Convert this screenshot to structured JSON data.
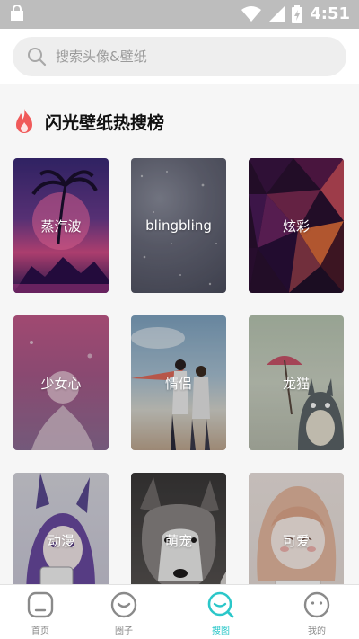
{
  "status_bar": {
    "time": "4:51"
  },
  "search": {
    "placeholder": "搜索头像&壁纸"
  },
  "section": {
    "title": "闪光壁纸热搜榜"
  },
  "cards": [
    {
      "label": "蒸汽波"
    },
    {
      "label": "blingbling"
    },
    {
      "label": "炫彩"
    },
    {
      "label": "少女心"
    },
    {
      "label": "情侣"
    },
    {
      "label": "龙猫"
    },
    {
      "label": "动漫"
    },
    {
      "label": "萌宠"
    },
    {
      "label": "可爱"
    }
  ],
  "bottom_nav": [
    {
      "label": "首页",
      "icon": "home-icon"
    },
    {
      "label": "圈子",
      "icon": "circle-face-icon"
    },
    {
      "label": "搜图",
      "icon": "search-image-icon",
      "active": true
    },
    {
      "label": "我的",
      "icon": "profile-face-icon"
    }
  ],
  "colors": {
    "accent": "#2bc7c9",
    "fire": "#f05a5a"
  }
}
